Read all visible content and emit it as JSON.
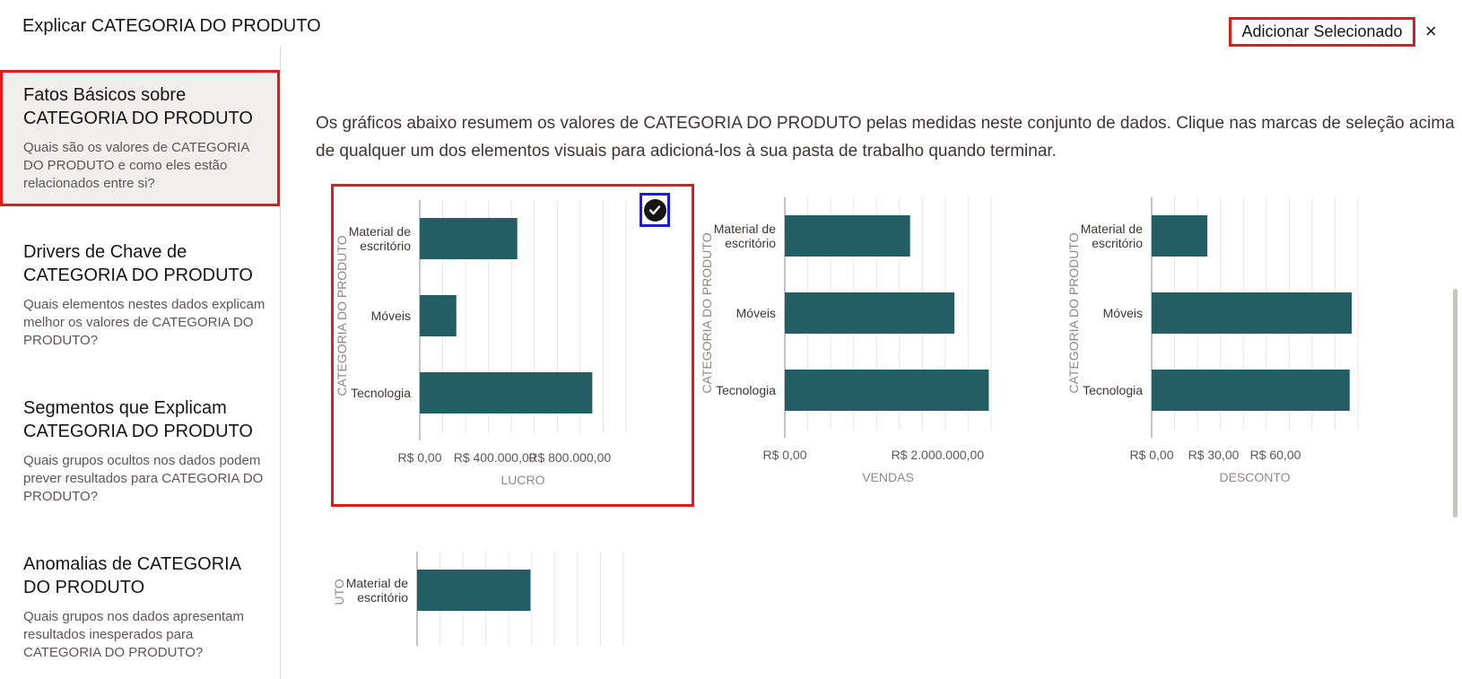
{
  "header": {
    "title": "Explicar CATEGORIA DO PRODUTO",
    "add_selected_label": "Adicionar Selecionado",
    "close_label": "×"
  },
  "sidebar": {
    "items": [
      {
        "title": "Fatos Básicos sobre CATEGORIA DO PRODUTO",
        "desc": "Quais são os valores de CATEGORIA DO PRODUTO e como eles estão relacionados entre si?"
      },
      {
        "title": "Drivers de Chave de CATEGORIA DO PRODUTO",
        "desc": "Quais elementos nestes dados explicam melhor os valores de CATEGORIA DO PRODUTO?"
      },
      {
        "title": "Segmentos que Explicam CATEGORIA DO PRODUTO",
        "desc": "Quais grupos ocultos nos dados podem prever resultados para CATEGORIA DO PRODUTO?"
      },
      {
        "title": "Anomalias de CATEGORIA DO PRODUTO",
        "desc": "Quais grupos nos dados apresentam resultados inesperados para CATEGORIA DO PRODUTO?"
      }
    ]
  },
  "main": {
    "intro": "Os gráficos abaixo resumem os valores de CATEGORIA DO PRODUTO pelas medidas neste conjunto de dados. Clique nas marcas de seleção acima de qualquer um dos elementos visuais para adicioná-los à sua pasta de trabalho quando terminar."
  },
  "colors": {
    "bar": "#245e65",
    "selection": "#e31a1a",
    "focus": "#1a1ae3",
    "axis_text": "#8d8985"
  },
  "chart_data": [
    {
      "type": "bar",
      "orientation": "horizontal",
      "selected": true,
      "categories": [
        "Material de escritório",
        "Móveis",
        "Tecnologia"
      ],
      "category_lines": [
        [
          "Material de",
          "escritório"
        ],
        [
          "Móveis"
        ],
        [
          "Tecnologia"
        ]
      ],
      "values": [
        520000,
        195000,
        920000
      ],
      "xlim": [
        0,
        1100000
      ],
      "ticks": [
        0,
        400000,
        800000
      ],
      "tick_labels": [
        "R$ 0,00",
        "R$ 400.000,00",
        "R$ 800.000,00"
      ],
      "xlabel": "LUCRO",
      "ylabel": "CATEGORIA DO PRODUTO",
      "grid": true
    },
    {
      "type": "bar",
      "orientation": "horizontal",
      "selected": false,
      "categories": [
        "Material de escritório",
        "Móveis",
        "Tecnologia"
      ],
      "category_lines": [
        [
          "Material de",
          "escritório"
        ],
        [
          "Móveis"
        ],
        [
          "Tecnologia"
        ]
      ],
      "values": [
        1640000,
        2220000,
        2670000
      ],
      "xlim": [
        0,
        2700000
      ],
      "ticks": [
        0,
        2000000
      ],
      "tick_labels": [
        "R$ 0,00",
        "R$ 2.000.000,00"
      ],
      "xlabel": "VENDAS",
      "ylabel": "CATEGORIA DO PRODUTO",
      "grid": true
    },
    {
      "type": "bar",
      "orientation": "horizontal",
      "selected": false,
      "categories": [
        "Material de escritório",
        "Móveis",
        "Tecnologia"
      ],
      "category_lines": [
        [
          "Material de",
          "escritório"
        ],
        [
          "Móveis"
        ],
        [
          "Tecnologia"
        ]
      ],
      "values": [
        27,
        97,
        96
      ],
      "xlim": [
        0,
        100
      ],
      "ticks": [
        0,
        30,
        60
      ],
      "tick_labels": [
        "R$ 0,00",
        "R$ 30,00",
        "R$ 60,00"
      ],
      "xlabel": "DESCONTO",
      "ylabel": "CATEGORIA DO PRODUTO",
      "grid": true
    },
    {
      "type": "bar",
      "orientation": "horizontal",
      "selected": false,
      "partial": true,
      "categories": [
        "Material de escritório"
      ],
      "category_lines": [
        [
          "Material de",
          "escritório"
        ]
      ],
      "values": [
        0.55
      ],
      "xlim": [
        0,
        1
      ],
      "ticks": [],
      "tick_labels": [],
      "xlabel": "",
      "ylabel": "UTO",
      "grid": true
    }
  ]
}
